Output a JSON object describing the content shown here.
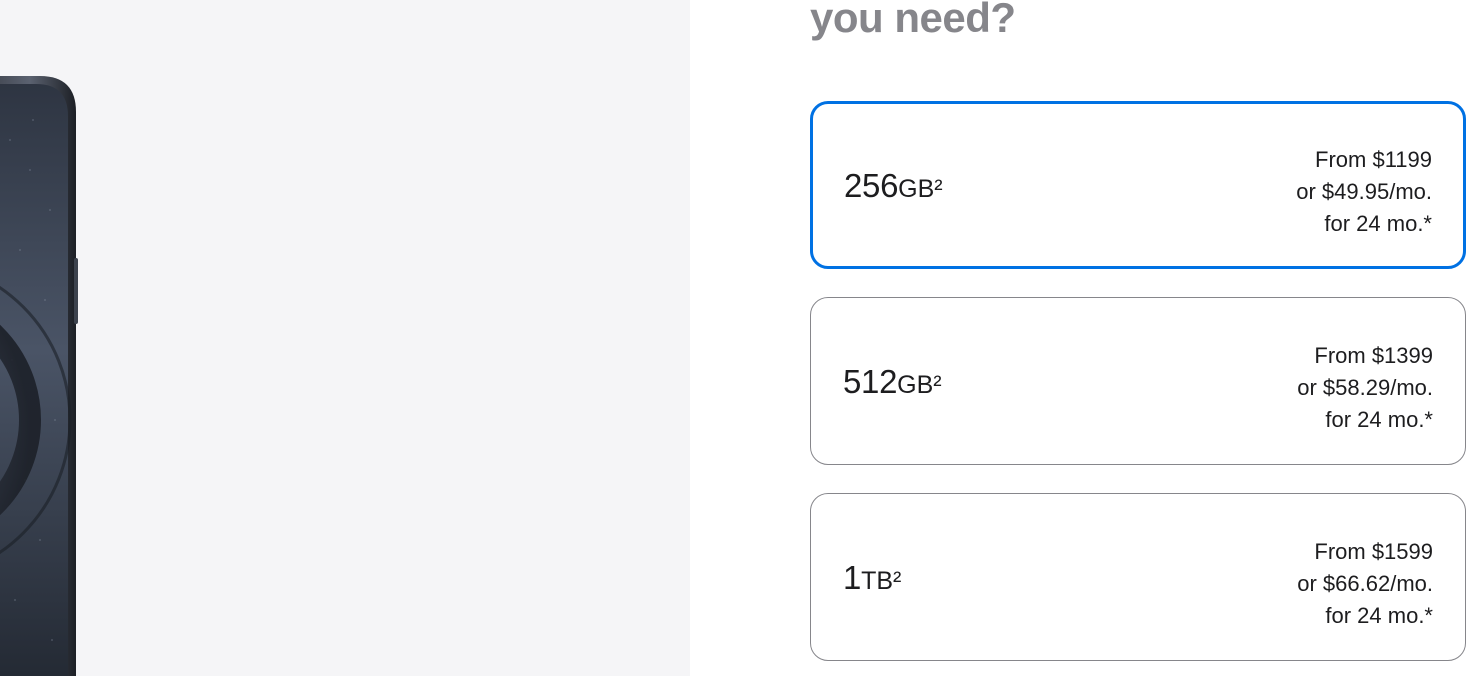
{
  "heading": {
    "text": "you need?"
  },
  "options": [
    {
      "capacity": "256",
      "unit": "GB²",
      "price_from": "From $1199",
      "price_monthly": "or $49.95/mo.",
      "price_term": "for 24 mo.*",
      "selected": true
    },
    {
      "capacity": "512",
      "unit": "GB²",
      "price_from": "From $1399",
      "price_monthly": "or $58.29/mo.",
      "price_term": "for 24 mo.*",
      "selected": false
    },
    {
      "capacity": "1",
      "unit": "TB²",
      "price_from": "From $1599",
      "price_monthly": "or $66.62/mo.",
      "price_term": "for 24 mo.*",
      "selected": false
    }
  ],
  "colors": {
    "accent": "#0071e3",
    "border": "#86868b",
    "gallery_bg": "#f5f5f7",
    "heading": "#86868b",
    "text": "#1d1d1f",
    "phone_finish": "#2a2f38"
  }
}
